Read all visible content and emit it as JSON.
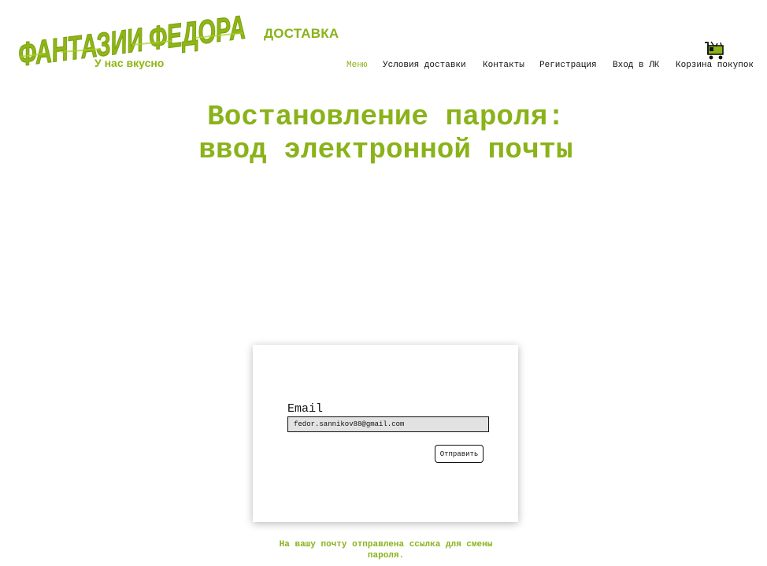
{
  "brand": {
    "logo_text": "ФАНТАЗИИ ФЕДОРА",
    "tagline": "У нас вкусно",
    "delivery_label": "ДОСТАВКА",
    "accent_color": "#8ab21a"
  },
  "nav": {
    "items": [
      {
        "label": "Меню",
        "active": true
      },
      {
        "label": "Условия доставки",
        "active": false
      },
      {
        "label": "Контакты",
        "active": false
      },
      {
        "label": "Регистрация",
        "active": false
      },
      {
        "label": "Вход в ЛК",
        "active": false
      },
      {
        "label": "Корзина покупок",
        "active": false
      }
    ],
    "cart_icon": "shopping-cart-icon"
  },
  "page": {
    "title_line1": "Востановление пароля:",
    "title_line2": "ввод электронной почты"
  },
  "form": {
    "email_label": "Email",
    "email_value": "fedor.sannikov88@gmail.com",
    "submit_label": "Отправить"
  },
  "notice": {
    "text": "На вашу почту отправлена ссылка для смены пароля."
  }
}
